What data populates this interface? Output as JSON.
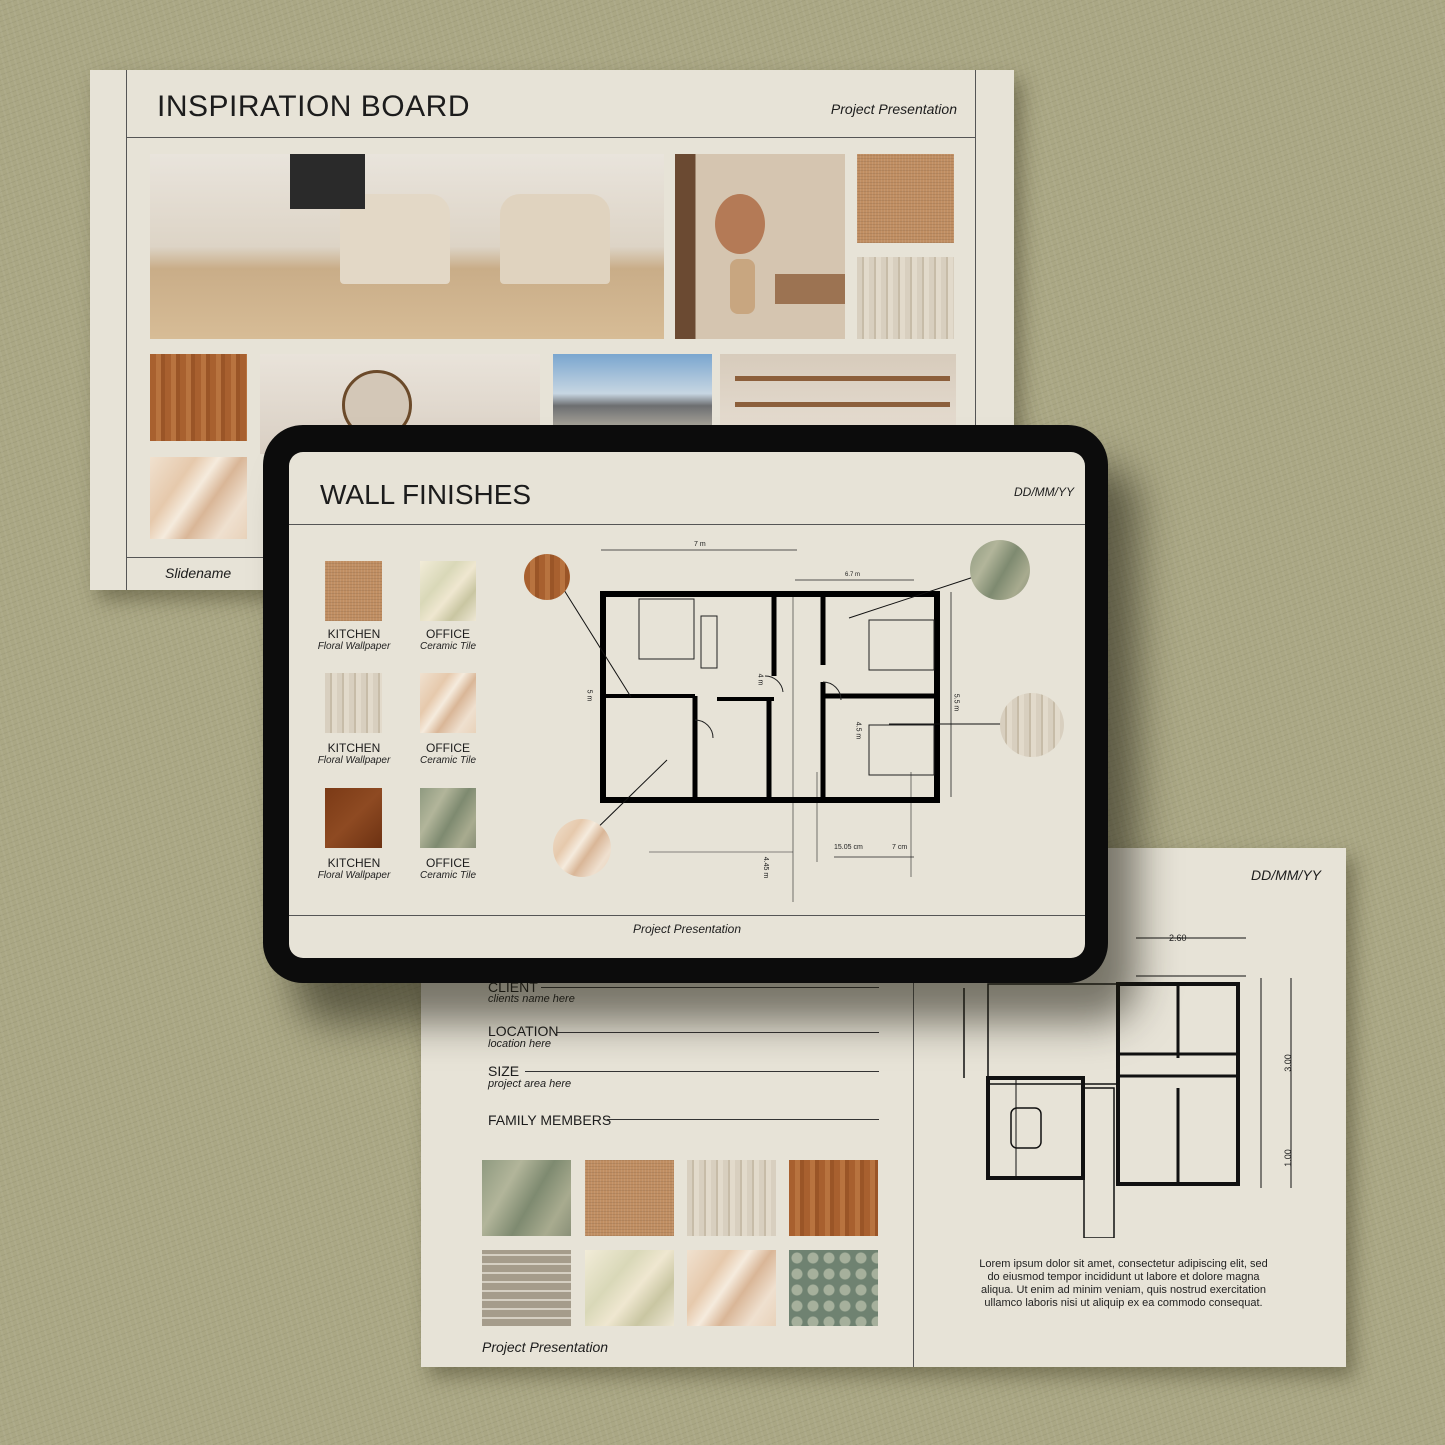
{
  "inspiration_board": {
    "title": "INSPIRATION BOARD",
    "subtitle": "Project Presentation",
    "footer": "Slidename"
  },
  "wall_finishes": {
    "title": "WALL FINISHES",
    "date": "DD/MM/YY",
    "footer": "Project Presentation",
    "swatches": [
      {
        "room": "KITCHEN",
        "finish": "Floral Wallpaper",
        "texture": "burlap"
      },
      {
        "room": "OFFICE",
        "finish": "Ceramic Tile",
        "texture": "onyx"
      },
      {
        "room": "KITCHEN",
        "finish": "Floral Wallpaper",
        "texture": "pale-wood"
      },
      {
        "room": "OFFICE",
        "finish": "Ceramic Tile",
        "texture": "marble"
      },
      {
        "room": "KITCHEN",
        "finish": "Floral Wallpaper",
        "texture": "brown-leather"
      },
      {
        "room": "OFFICE",
        "finish": "Ceramic Tile",
        "texture": "green-marble"
      }
    ],
    "plan_dims": {
      "top": "7 m",
      "right_top": "6.7 m",
      "left": "5 m",
      "mid": "4 m",
      "right": "5.5 m",
      "room": "4.5 m",
      "bottom": "4.45 m",
      "b1": "15.05 cm",
      "b2": "7 cm"
    }
  },
  "project_info": {
    "date": "DD/MM/YY",
    "fields": [
      {
        "label": "CLIENT",
        "value": "clients name here"
      },
      {
        "label": "LOCATION",
        "value": "location here"
      },
      {
        "label": "SIZE",
        "value": "project area here"
      },
      {
        "label": "FAMILY MEMBERS",
        "value": ""
      }
    ],
    "dims": {
      "top": "2.60",
      "right1": "3.00",
      "right2": "1.00"
    },
    "description": "Lorem ipsum dolor sit amet,  consectetur adipiscing elit, sed do  eiusmod tempor incididunt ut labore et dolore magna aliqua. Ut enim ad minim veniam, quis nostrud exercitation ullamco laboris nisi ut aliquip ex ea commodo consequat.",
    "footer": "Project Presentation"
  }
}
